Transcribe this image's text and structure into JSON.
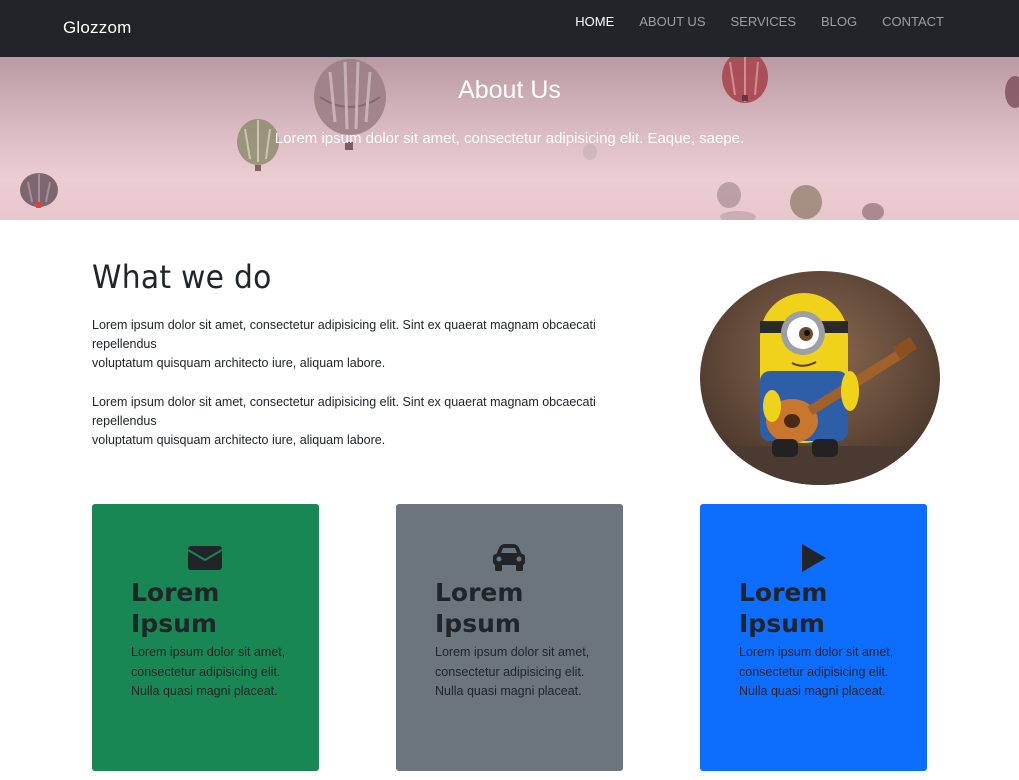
{
  "navbar": {
    "brand": "Glozzom",
    "items": [
      {
        "label": "HOME",
        "active": true
      },
      {
        "label": "ABOUT US",
        "active": false
      },
      {
        "label": "SERVICES",
        "active": false
      },
      {
        "label": "BLOG",
        "active": false
      },
      {
        "label": "CONTACT",
        "active": false
      }
    ]
  },
  "hero": {
    "title": "About Us",
    "subtitle": "Lorem ipsum dolor sit amet, consectetur adipisicing elit. Eaque, saepe."
  },
  "what_we_do": {
    "title": "What we do",
    "paragraphs": [
      {
        "line1": "Lorem ipsum dolor sit amet, consectetur adipisicing elit. Sint ex quaerat magnam obcaecati",
        "line2": "repellendus",
        "line3": "voluptatum quisquam architecto iure, aliquam labore."
      },
      {
        "line1": "Lorem ipsum dolor sit amet, consectetur adipisicing elit. Sint ex quaerat magnam obcaecati",
        "line2": "repellendus",
        "line3": "voluptatum quisquam architecto iure, aliquam labore."
      }
    ]
  },
  "cards": [
    {
      "icon": "envelope-icon",
      "title_line1": "Lorem",
      "title_line2": "Ipsum",
      "text": "Lorem ipsum dolor sit amet, consectetur adipisicing elit. Nulla quasi magni placeat.",
      "color": "#198754"
    },
    {
      "icon": "car-icon",
      "title_line1": "Lorem",
      "title_line2": "Ipsum",
      "text": "Lorem ipsum dolor sit amet, consectetur adipisicing elit. Nulla quasi magni placeat.",
      "color": "#6c757d"
    },
    {
      "icon": "play-icon",
      "title_line1": "Lorem",
      "title_line2": "Ipsum",
      "text": "Lorem ipsum dolor sit amet, consectetur adipisicing elit. Nulla quasi magni placeat.",
      "color": "#0d6efd"
    }
  ],
  "colors": {
    "navbar_bg": "#212529",
    "nav_active": "#ffffff",
    "nav_inactive": "#8c8f91",
    "card_green": "#198754",
    "card_gray": "#6c757d",
    "card_blue": "#0d6efd"
  }
}
